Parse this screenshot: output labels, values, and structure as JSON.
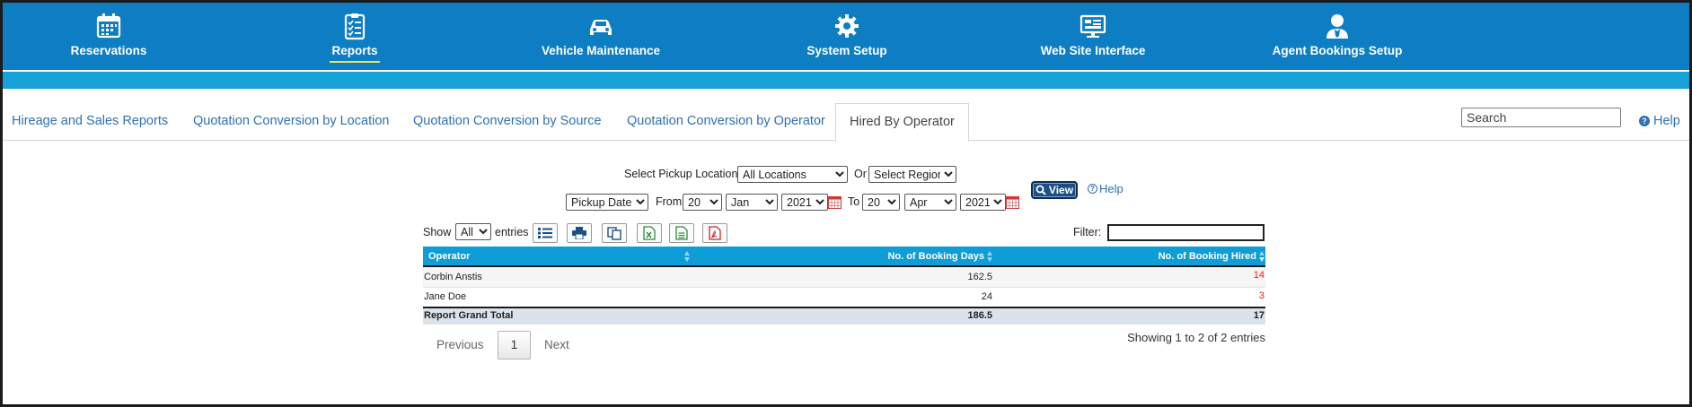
{
  "nav": {
    "items": [
      {
        "label": "Reservations",
        "icon": "calendar-icon"
      },
      {
        "label": "Reports",
        "icon": "clipboard-checklist-icon",
        "active": true
      },
      {
        "label": "Vehicle Maintenance",
        "icon": "car-icon"
      },
      {
        "label": "System Setup",
        "icon": "gear-icon"
      },
      {
        "label": "Web Site Interface",
        "icon": "monitor-icon"
      },
      {
        "label": "Agent Bookings Setup",
        "icon": "agent-user-icon"
      }
    ],
    "active_underline_color": "#f4e64a",
    "bar_color": "#0d7ec4",
    "subbar_color": "#16a2d8"
  },
  "tabs": [
    {
      "label": "Hireage and Sales Reports"
    },
    {
      "label": "Quotation Conversion by Location"
    },
    {
      "label": "Quotation Conversion by Source"
    },
    {
      "label": "Quotation Conversion by Operator"
    },
    {
      "label": "Hired By Operator",
      "active": true
    }
  ],
  "search": {
    "placeholder": "Search",
    "value": ""
  },
  "help_label": "Help",
  "form": {
    "pickup_location_label": "Select Pickup Location",
    "pickup_location_value": "All Locations",
    "or_label": "Or",
    "region_value": "Select Region",
    "date_type_value": "Pickup Date",
    "from_label": "From",
    "from_day": "20",
    "from_month": "Jan",
    "from_year": "2021",
    "to_label": "To",
    "to_day": "20",
    "to_month": "Apr",
    "to_year": "2021",
    "view_label": "View",
    "help_label": "Help"
  },
  "toolbar": {
    "show_label": "Show",
    "entries_value": "All",
    "entries_label": "entries",
    "filter_label": "Filter:",
    "filter_value": "",
    "buttons": [
      {
        "icon": "column-list-icon"
      },
      {
        "icon": "print-icon"
      },
      {
        "icon": "copy-icon"
      },
      {
        "icon": "excel-icon"
      },
      {
        "icon": "csv-icon"
      },
      {
        "icon": "pdf-icon"
      }
    ]
  },
  "table": {
    "columns": [
      "Operator",
      "No. of Booking Days",
      "No. of Booking Hired"
    ],
    "rows": [
      {
        "operator": "Corbin Anstis",
        "days": "162.5",
        "hired": "14"
      },
      {
        "operator": "Jane Doe",
        "days": "24",
        "hired": "3"
      }
    ],
    "total": {
      "label": "Report Grand Total",
      "days": "186.5",
      "hired": "17"
    },
    "header_color": "#0e9dd6",
    "hired_value_color": "#e51c1c"
  },
  "pagination": {
    "previous": "Previous",
    "current": "1",
    "next": "Next",
    "info": "Showing 1 to 2 of 2 entries"
  }
}
